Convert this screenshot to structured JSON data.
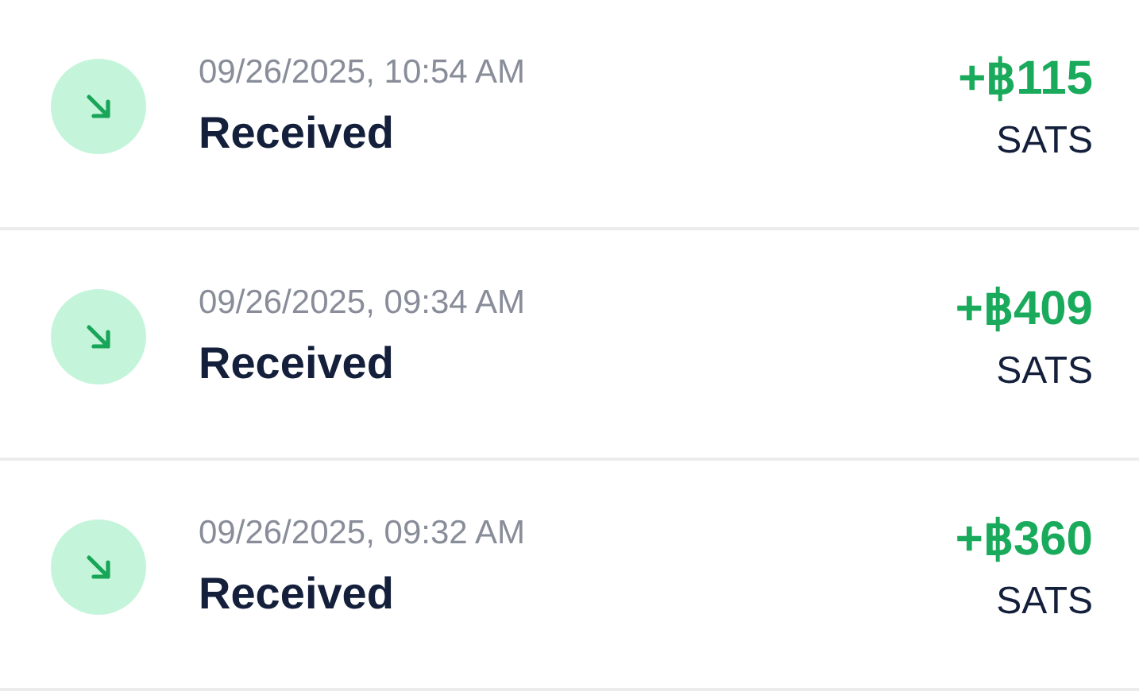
{
  "transactions": [
    {
      "date": "09/26/2025, 10:54 AM",
      "type": "Received",
      "amount": "+฿115",
      "unit": "SATS"
    },
    {
      "date": "09/26/2025, 09:34 AM",
      "type": "Received",
      "amount": "+฿409",
      "unit": "SATS"
    },
    {
      "date": "09/26/2025, 09:32 AM",
      "type": "Received",
      "amount": "+฿360",
      "unit": "SATS"
    }
  ]
}
